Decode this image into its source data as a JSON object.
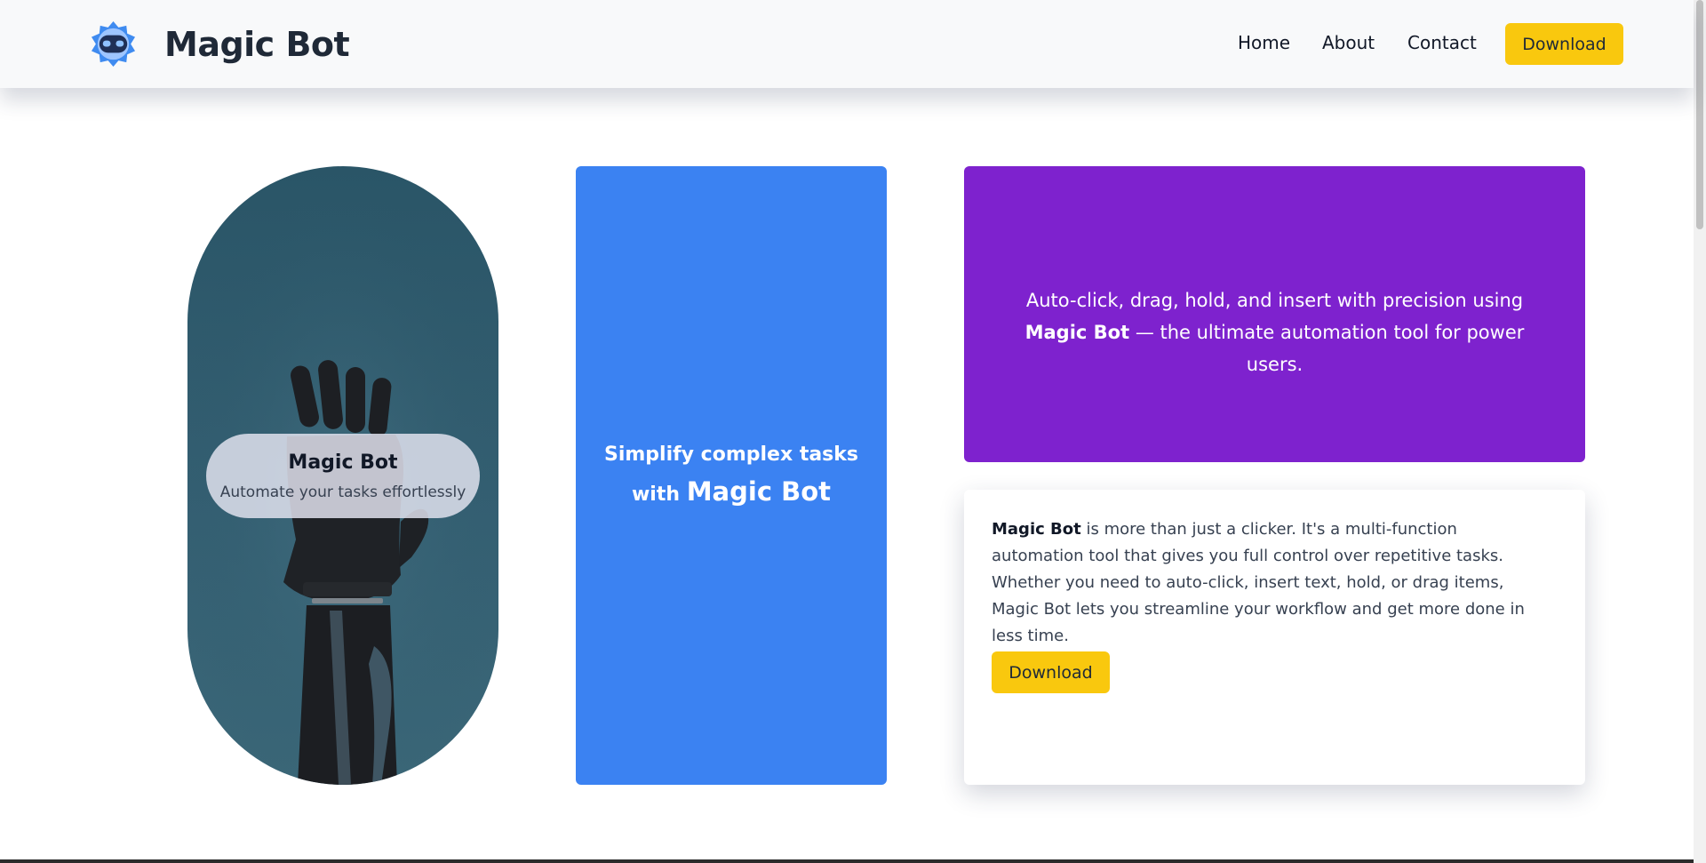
{
  "navbar": {
    "brand": "Magic Bot",
    "links": [
      {
        "label": "Home"
      },
      {
        "label": "About"
      },
      {
        "label": "Contact"
      }
    ],
    "download_label": "Download"
  },
  "hero": {
    "pill_title": "Magic Bot",
    "pill_subtitle": "Automate your tasks effortlessly",
    "blue_line1": "Simplify complex tasks",
    "blue_line2_prefix": "with",
    "blue_line2_brand": "Magic Bot",
    "purple_before": "Auto-click, drag, hold, and insert with precision using",
    "purple_brand": "Magic Bot",
    "purple_after": "— the ultimate automation tool for power users.",
    "desc_brand": "Magic Bot",
    "desc_text": "is more than just a clicker. It's a multi-function automation tool that gives you full control over repetitive tasks. Whether you need to auto-click, insert text, hold, or drag items, Magic Bot lets you streamline your workflow and get more done in less time.",
    "download_label": "Download"
  },
  "colors": {
    "accent_yellow": "#f9c80e",
    "blue_card": "#3b82f2",
    "purple_card": "#7e22ce",
    "pill_bg": "#2a5567"
  },
  "icons": {
    "logo": "robot-gear-icon"
  }
}
